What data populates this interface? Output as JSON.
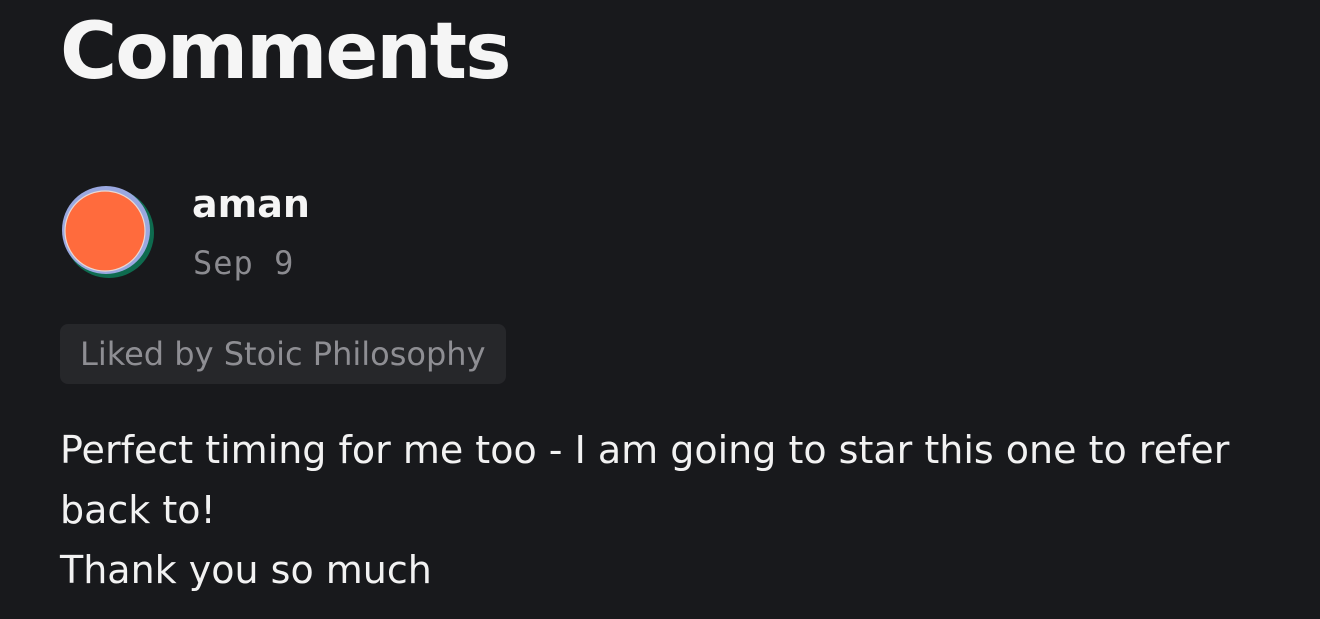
{
  "section": {
    "title": "Comments"
  },
  "comment": {
    "author": "aman",
    "date": "Sep 9",
    "liked_by": "Liked by Stoic Philosophy",
    "body_lines": [
      "Perfect timing for me too - I am going to star this one to refer back to!",
      "Thank you so much"
    ],
    "avatar": {
      "icon": "user-avatar-icon",
      "colors": {
        "fill": "#ff6b3d",
        "rim_top": "#9aa8e0",
        "rim_right": "#0e6b4f",
        "rim_bottom": "#f6b21a"
      }
    }
  },
  "colors": {
    "background": "#18191c",
    "badge_background": "#26272a",
    "muted_text": "#8b8b90",
    "primary_text": "#f5f5f5"
  }
}
